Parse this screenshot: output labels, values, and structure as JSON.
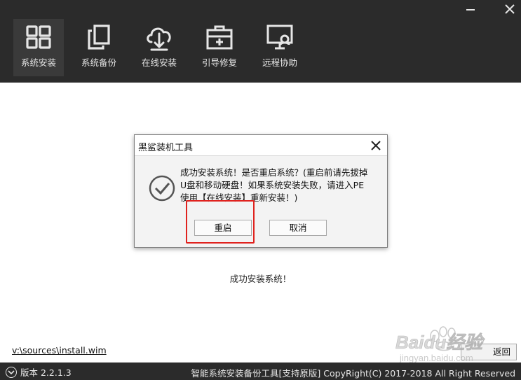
{
  "toolbar": {
    "items": [
      {
        "label": "系统安装",
        "icon": "windows-icon",
        "active": true
      },
      {
        "label": "系统备份",
        "icon": "copy-icon",
        "active": false
      },
      {
        "label": "在线安装",
        "icon": "cloud-download-icon",
        "active": false
      },
      {
        "label": "引导修复",
        "icon": "toolbox-icon",
        "active": false
      },
      {
        "label": "远程协助",
        "icon": "remote-monitor-icon",
        "active": false
      }
    ]
  },
  "window": {
    "minimize_icon": "minimize-icon",
    "close_icon": "close-icon"
  },
  "dialog": {
    "title": "黑鲨装机工具",
    "icon": "check-circle-icon",
    "message_line1": "成功安装系统！是否重启系统？(重启前请先拔掉",
    "message_line2": "U盘和移动硬盘！如果系统安装失败，请进入PE",
    "message_line3": "使用【在线安装】重新安装！)",
    "restart_label": "重启",
    "cancel_label": "取消"
  },
  "main": {
    "status_message": "成功安装系统！",
    "wim_path": "v:\\sources\\install.wim",
    "back_label": "返回"
  },
  "statusbar": {
    "version": "版本 2.2.1.3",
    "copyright": "智能系统安装备份工具[支持原版]  CopyRight(C) 2017-2018 All Right Reserved"
  },
  "watermark": {
    "brand": "Baidu经验",
    "url": "jingyan.baidu.com"
  },
  "colors": {
    "toolbar_bg": "#2b2b2b",
    "highlight": "#e0221e"
  }
}
